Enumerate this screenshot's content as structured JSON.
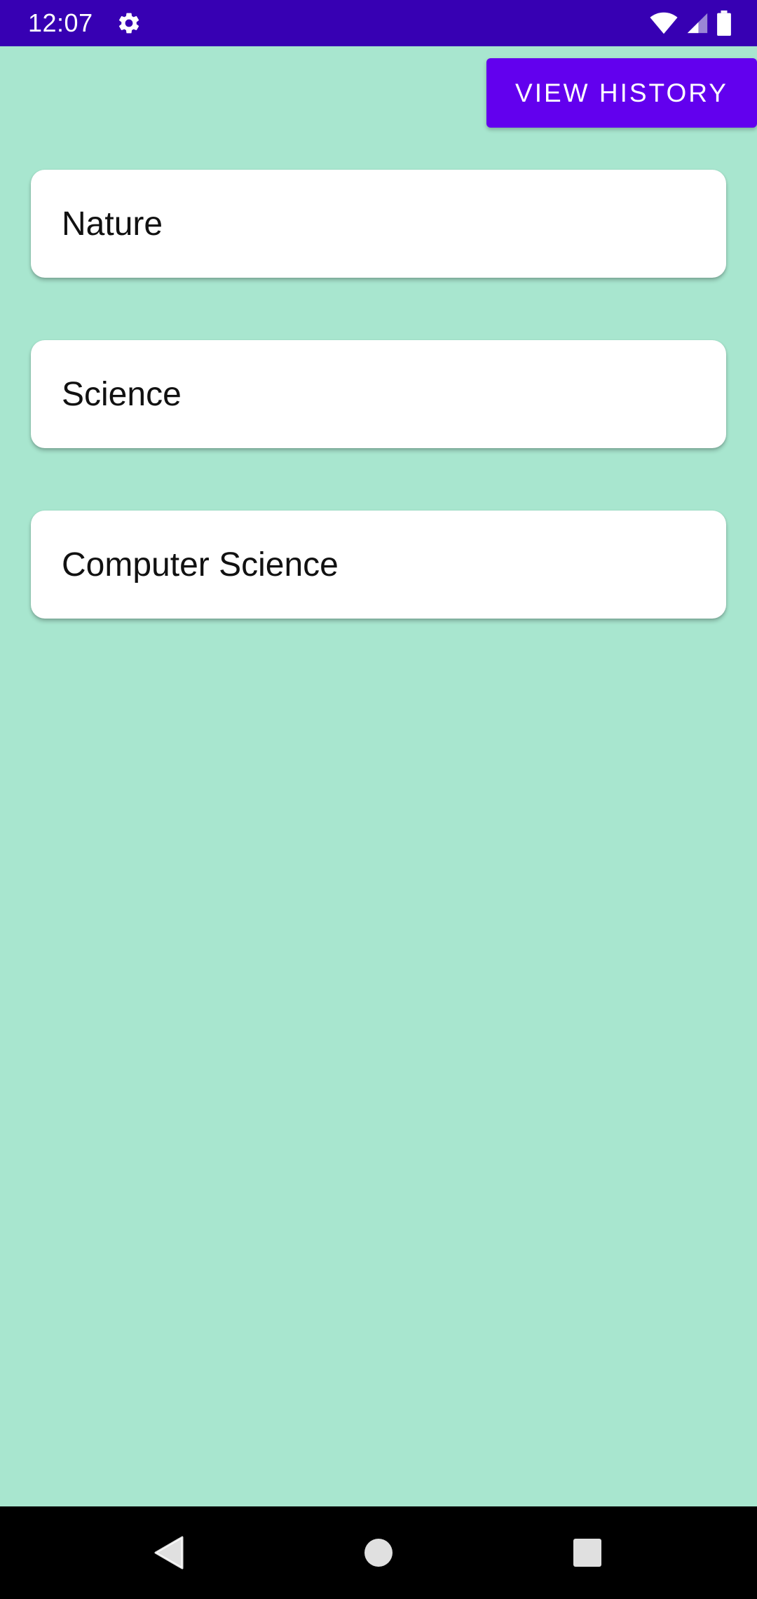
{
  "status_bar": {
    "time": "12:07",
    "icons": [
      "gear-icon",
      "wifi-icon",
      "signal-icon",
      "battery-icon"
    ],
    "background": "#3700B3"
  },
  "toolbar": {
    "view_history_label": "VIEW HISTORY",
    "accent": "#6200EE"
  },
  "categories": [
    {
      "label": "Nature"
    },
    {
      "label": "Science"
    },
    {
      "label": "Computer Science"
    }
  ],
  "nav_bar": {
    "icons": [
      "back-icon",
      "home-icon",
      "recents-icon"
    ]
  },
  "colors": {
    "background": "#A8E6CF",
    "card": "#FFFFFF"
  }
}
